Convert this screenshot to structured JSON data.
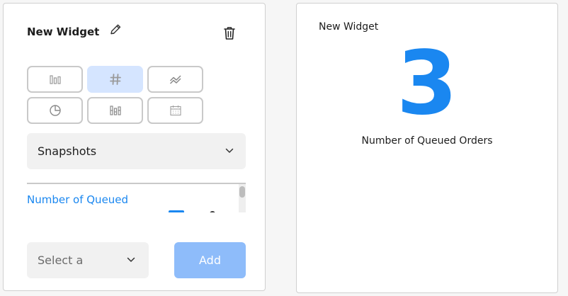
{
  "editor": {
    "title": "New Widget",
    "icons": {
      "edit": "pencil-icon",
      "delete": "trash-icon"
    },
    "chart_types": [
      {
        "icon": "bar-chart-icon",
        "active": false
      },
      {
        "icon": "number-icon",
        "active": true
      },
      {
        "icon": "line-chart-icon",
        "active": false
      },
      {
        "icon": "pie-chart-icon",
        "active": false
      },
      {
        "icon": "stacked-bar-icon",
        "active": false
      },
      {
        "icon": "calendar-icon",
        "active": false
      }
    ],
    "snapshot_select": {
      "value": "Snapshots"
    },
    "metrics": [
      {
        "label": "Number of Queued"
      }
    ],
    "field_select": {
      "value": "Select a"
    },
    "add_label": "Add"
  },
  "preview": {
    "title": "New Widget",
    "value": "3",
    "caption": "Number of Queued Orders"
  },
  "colors": {
    "accent": "#1a87f0",
    "active_tile": "#d5e5ff",
    "add_button": "#8ebcfa"
  }
}
